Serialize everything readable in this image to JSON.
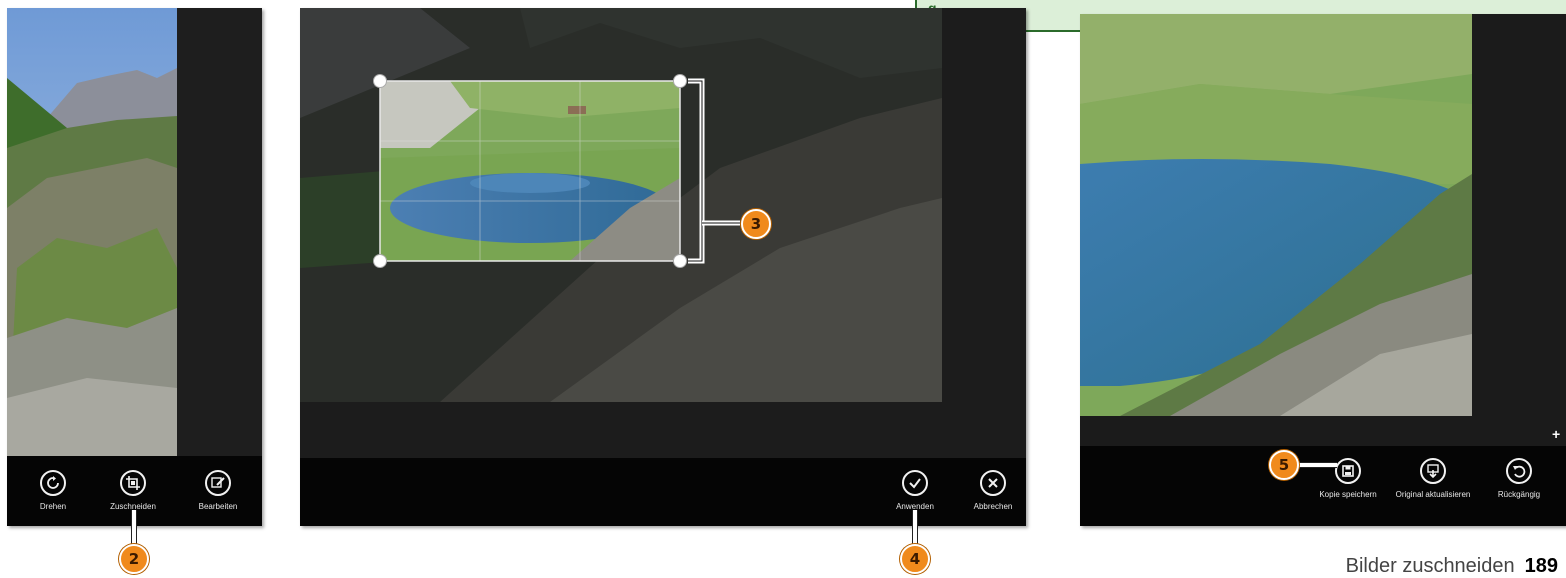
{
  "panel1": {
    "commands": [
      {
        "label": "Drehen",
        "icon": "rotate-icon"
      },
      {
        "label": "Zuschneiden",
        "icon": "crop-icon"
      },
      {
        "label": "Bearbeiten",
        "icon": "edit-icon"
      }
    ],
    "callout": "2"
  },
  "panel2": {
    "commands": [
      {
        "label": "Anwenden",
        "icon": "checkmark-icon"
      },
      {
        "label": "Abbrechen",
        "icon": "close-icon"
      }
    ],
    "callout_crop": "3",
    "callout_apply": "4"
  },
  "panel3": {
    "commands": [
      {
        "label": "Kopie speichern",
        "icon": "save-copy-icon"
      },
      {
        "label": "Original aktualisieren",
        "icon": "update-original-icon"
      },
      {
        "label": "Rückgängig",
        "icon": "undo-icon"
      }
    ],
    "callout": "5",
    "plus": "+"
  },
  "footer": {
    "title": "Bilder zuschneiden",
    "page": "189"
  },
  "colors": {
    "callout": "#f08a1c",
    "info_box": "#dcefd8",
    "info_box_border": "#2b6b2b"
  }
}
